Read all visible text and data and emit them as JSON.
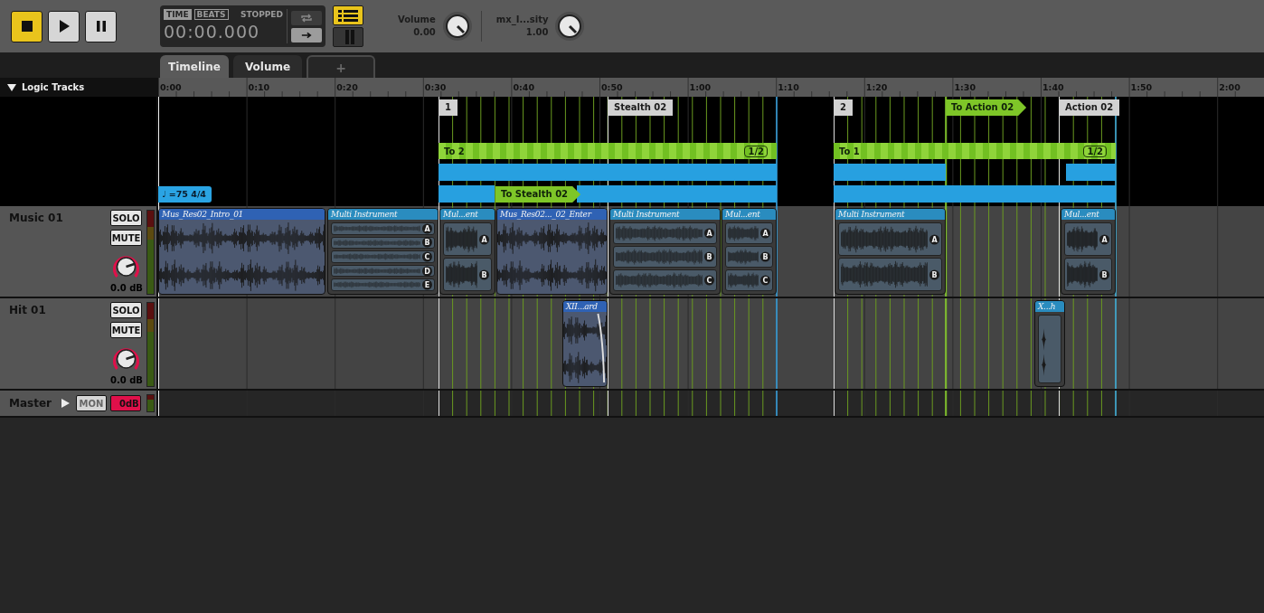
{
  "transport": [
    {
      "kind": "stop",
      "on": true
    },
    {
      "kind": "play",
      "on": false
    },
    {
      "kind": "pause",
      "on": false
    }
  ],
  "time_display": {
    "modes": [
      {
        "label": "TIME",
        "selected": true
      },
      {
        "label": "BEATS",
        "selected": false
      }
    ],
    "status": "STOPPED",
    "time": "00:00.000",
    "loop": {
      "on": false
    },
    "follow": {
      "on": true
    }
  },
  "view_buttons": [
    {
      "kind": "list",
      "on": true
    },
    {
      "kind": "split",
      "on": false
    }
  ],
  "parameters": [
    {
      "name": "Volume",
      "value": "0.00"
    },
    {
      "name": "mx_I...sity",
      "value": "1.00"
    }
  ],
  "tabs": [
    {
      "label": "Timeline",
      "selected": true
    },
    {
      "label": "Volume",
      "selected": false
    }
  ],
  "add_tab": {
    "label": "+"
  },
  "logic_tracks": {
    "label": "Logic Tracks",
    "expanded": true
  },
  "ruler": [
    "0:00",
    "0:10",
    "0:20",
    "0:30",
    "0:40",
    "0:50",
    "1:00",
    "1:10",
    "1:20",
    "1:30",
    "1:40",
    "1:50",
    "2:00"
  ],
  "destination_markers": [
    {
      "label": "1"
    },
    {
      "label": "Stealth 02"
    },
    {
      "label": "2"
    },
    {
      "label": "Action 02"
    }
  ],
  "transition_markers": [
    {
      "label": "To Action 02"
    },
    {
      "label": "To Stealth 02"
    }
  ],
  "loop_regions": [
    {
      "label": "To 2",
      "count": "1/2",
      "reverse": false
    },
    {
      "label": "To 1",
      "count": "1/2",
      "reverse": true
    }
  ],
  "tempo_marker": {
    "symbol": "♩",
    "label": "=75 4/4"
  },
  "tracks": [
    {
      "name": "Music 01",
      "solo": {
        "label": "SOLO",
        "on": false
      },
      "mute": {
        "label": "MUTE",
        "on": false
      },
      "volume": "0.0 dB",
      "clips": [
        {
          "title": "Mus_Res02_Intro_01",
          "kind": "single"
        },
        {
          "title": "Multi Instrument",
          "kind": "multi",
          "layers": [
            "A",
            "B",
            "C",
            "D",
            "E"
          ]
        },
        {
          "title": "Mul...ent",
          "kind": "multi",
          "layers": [
            "A",
            "B"
          ]
        },
        {
          "title": "Mus_Res02..._02_Enter",
          "kind": "single"
        },
        {
          "title": "Multi Instrument",
          "kind": "multi",
          "layers": [
            "A",
            "B",
            "C"
          ]
        },
        {
          "title": "Mul...ent",
          "kind": "multi",
          "layers": [
            "A",
            "B",
            "C"
          ]
        },
        {
          "title": "Multi Instrument",
          "kind": "multi",
          "layers": [
            "A",
            "B"
          ]
        },
        {
          "title": "Mul...ent",
          "kind": "multi",
          "layers": [
            "A",
            "B"
          ]
        }
      ]
    },
    {
      "name": "Hit 01",
      "solo": {
        "label": "SOLO",
        "on": false
      },
      "mute": {
        "label": "MUTE",
        "on": false
      },
      "volume": "0.0 dB",
      "clips": [
        {
          "title": "XII...ard",
          "kind": "single"
        },
        {
          "title": "X...h",
          "kind": "multi"
        }
      ]
    }
  ],
  "master": {
    "name": "Master",
    "monitor": {
      "label": "MON",
      "on": false
    },
    "volume": "0dB"
  }
}
